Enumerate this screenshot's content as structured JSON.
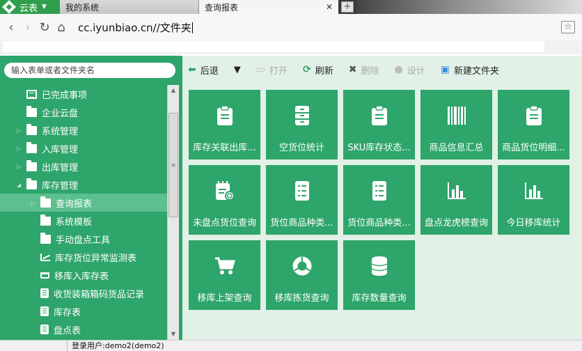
{
  "browser": {
    "app_tab": "云表",
    "tabs": [
      {
        "label": "我的系统",
        "active": false
      },
      {
        "label": "查询报表",
        "active": true
      }
    ],
    "address": "cc.iyunbiao.cn//文件夹"
  },
  "sidebar": {
    "search_placeholder": "输入表单或者文件夹名",
    "items": [
      {
        "label": "已完成事项",
        "icon": "list-icon",
        "level": 1,
        "arrow": ""
      },
      {
        "label": "企业云盘",
        "icon": "folder-icon",
        "level": 1,
        "arrow": ""
      },
      {
        "label": "系统管理",
        "icon": "folder-icon",
        "level": 1,
        "arrow": "collapsed"
      },
      {
        "label": "入库管理",
        "icon": "folder-icon",
        "level": 1,
        "arrow": "collapsed"
      },
      {
        "label": "出库管理",
        "icon": "folder-icon",
        "level": 1,
        "arrow": "collapsed"
      },
      {
        "label": "库存管理",
        "icon": "folder-icon",
        "level": 1,
        "arrow": "expanded"
      },
      {
        "label": "查询报表",
        "icon": "folder-icon",
        "level": 2,
        "arrow": "collapsed",
        "selected": true
      },
      {
        "label": "系统模板",
        "icon": "folder-icon",
        "level": 2,
        "arrow": ""
      },
      {
        "label": "手动盘点工具",
        "icon": "folder-icon",
        "level": 2,
        "arrow": ""
      },
      {
        "label": "库存货位异常监测表",
        "icon": "chart-icon",
        "level": 2,
        "arrow": ""
      },
      {
        "label": "移库入库存表",
        "icon": "cart-icon",
        "level": 2,
        "arrow": ""
      },
      {
        "label": "收货装箱箱码货品记录",
        "icon": "clipboard-icon",
        "level": 2,
        "arrow": ""
      },
      {
        "label": "库存表",
        "icon": "clipboard-icon",
        "level": 2,
        "arrow": ""
      },
      {
        "label": "盘点表",
        "icon": "clipboard-icon",
        "level": 2,
        "arrow": ""
      }
    ]
  },
  "toolbar": {
    "back": "后退",
    "open": "打开",
    "refresh": "刷新",
    "delete": "删除",
    "design": "设计",
    "new_folder": "新建文件夹"
  },
  "tiles": [
    {
      "label": "库存关联出库...",
      "icon": "clipboard-icon"
    },
    {
      "label": "空货位统计",
      "icon": "cabinet-icon"
    },
    {
      "label": "SKU库存状态...",
      "icon": "clipboard-icon"
    },
    {
      "label": "商品信息汇总",
      "icon": "barcode-icon"
    },
    {
      "label": "商品货位明细...",
      "icon": "clipboard-icon"
    },
    {
      "label": "未盘点货位查询",
      "icon": "notepad-search-icon"
    },
    {
      "label": "货位商品种类...",
      "icon": "list-doc-icon"
    },
    {
      "label": "货位商品种类...",
      "icon": "list-doc-icon"
    },
    {
      "label": "盘点龙虎榜查询",
      "icon": "bar-chart-icon"
    },
    {
      "label": "今日移库统计",
      "icon": "bar-chart-icon"
    },
    {
      "label": "移库上架查询",
      "icon": "cart-icon"
    },
    {
      "label": "移库拣货查询",
      "icon": "donut-icon"
    },
    {
      "label": "库存数量查询",
      "icon": "database-icon"
    }
  ],
  "status": {
    "user": "登录用户:demo2(demo2)"
  }
}
